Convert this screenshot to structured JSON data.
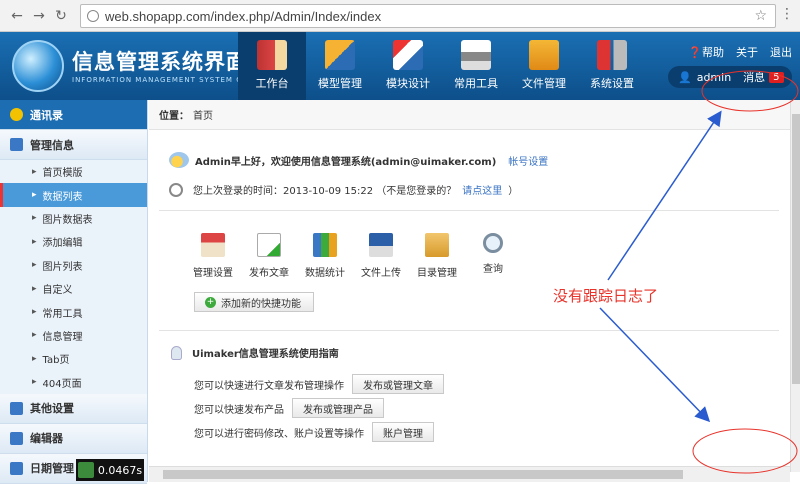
{
  "browser": {
    "url": "web.shopapp.com/index.php/Admin/Index/index"
  },
  "header": {
    "title": "信息管理系统界面",
    "subtitle": "INFORMATION MANAGEMENT SYSTEM GUI",
    "nav": [
      {
        "label": "工作台",
        "active": true
      },
      {
        "label": "模型管理"
      },
      {
        "label": "模块设计"
      },
      {
        "label": "常用工具"
      },
      {
        "label": "文件管理"
      },
      {
        "label": "系统设置"
      }
    ],
    "top_links": {
      "help": "帮助",
      "about": "关于",
      "logout": "退出"
    },
    "user": {
      "name": "admin",
      "messages_label": "消息",
      "message_count": "5"
    }
  },
  "sidebar": {
    "address_book": "通讯录",
    "manage_info": "管理信息",
    "items": [
      "首页模版",
      "数据列表",
      "图片数据表",
      "添加编辑",
      "图片列表",
      "自定义",
      "常用工具",
      "信息管理",
      "Tab页",
      "404页面"
    ],
    "active_index": 1,
    "other_settings": "其他设置",
    "editor": "编辑器",
    "date_manage": "日期管理",
    "timer": "0.0467s"
  },
  "main": {
    "breadcrumb_label": "位置：",
    "breadcrumb_page": "首页",
    "welcome": "Admin早上好，欢迎使用信息管理系统(admin@uimaker.com)",
    "account_settings": "帐号设置",
    "last_login": "您上次登录的时间：2013-10-09 15:22 （不是您登录的？",
    "click_here": "请点这里",
    "last_login_close": "）",
    "quick": [
      "管理设置",
      "发布文章",
      "数据统计",
      "文件上传",
      "目录管理",
      "查询"
    ],
    "add_shortcut": "添加新的快捷功能",
    "guide_title": "Uimaker信息管理系统使用指南",
    "guide": [
      {
        "text": "您可以快速进行文章发布管理操作",
        "button": "发布或管理文章"
      },
      {
        "text": "您可以快速发布产品",
        "button": "发布或管理产品"
      },
      {
        "text": "您可以进行密码修改、账户设置等操作",
        "button": "账户管理"
      }
    ]
  },
  "annotation": {
    "text": "没有跟踪日志了",
    "color": "#e8322a"
  }
}
